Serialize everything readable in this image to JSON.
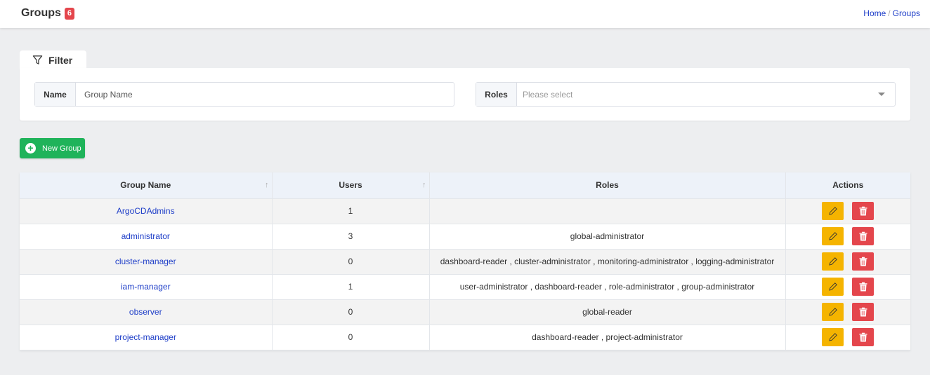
{
  "header": {
    "title": "Groups",
    "count": "6",
    "breadcrumb": [
      {
        "label": "Home"
      },
      {
        "label": "Groups"
      }
    ]
  },
  "filter": {
    "tab_label": "Filter",
    "name_label": "Name",
    "name_placeholder": "Group Name",
    "roles_label": "Roles",
    "roles_placeholder": "Please select"
  },
  "actions": {
    "new_group_label": "New Group"
  },
  "table": {
    "columns": [
      "Group Name",
      "Users",
      "Roles",
      "Actions"
    ],
    "rows": [
      {
        "name": "ArgoCDAdmins",
        "users": "1",
        "roles": ""
      },
      {
        "name": "administrator",
        "users": "3",
        "roles": "global-administrator"
      },
      {
        "name": "cluster-manager",
        "users": "0",
        "roles": "dashboard-reader , cluster-administrator , monitoring-administrator , logging-administrator"
      },
      {
        "name": "iam-manager",
        "users": "1",
        "roles": "user-administrator , dashboard-reader , role-administrator , group-administrator"
      },
      {
        "name": "observer",
        "users": "0",
        "roles": "global-reader"
      },
      {
        "name": "project-manager",
        "users": "0",
        "roles": "dashboard-reader , project-administrator"
      }
    ]
  },
  "colors": {
    "accent_link": "#1e3ec8",
    "badge": "#e4464c",
    "new_button": "#1fb35a",
    "edit_button": "#f5b400",
    "delete_button": "#e4464c"
  },
  "icons": {
    "filter": "filter-icon",
    "new": "plus-circle-icon",
    "edit": "pencil-icon",
    "delete": "trash-icon",
    "sort": "sort-arrow-icon",
    "dropdown": "chevron-down-icon"
  }
}
